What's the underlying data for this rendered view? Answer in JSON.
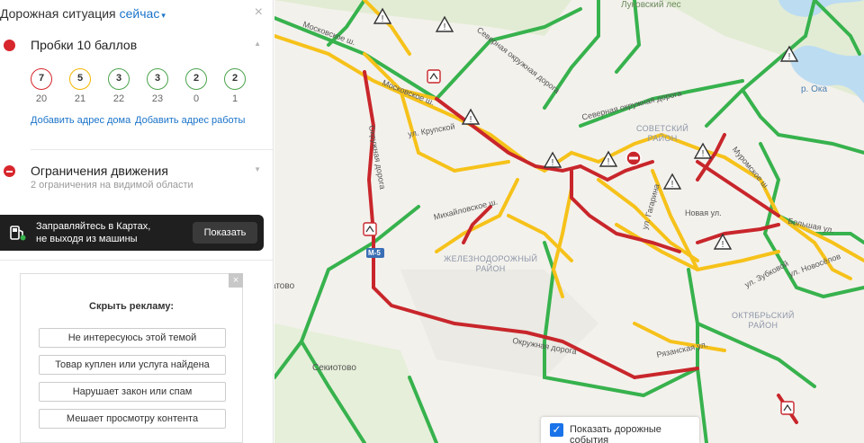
{
  "header": {
    "title": "Дорожная ситуация",
    "time_link": "сейчас",
    "caret": "▾",
    "close": "×"
  },
  "jams": {
    "title": "Пробки 10 баллов",
    "forecast": [
      {
        "score": "7",
        "hour": "20",
        "level": "red"
      },
      {
        "score": "5",
        "hour": "21",
        "level": "yellow"
      },
      {
        "score": "3",
        "hour": "22",
        "level": "green"
      },
      {
        "score": "3",
        "hour": "23",
        "level": "green"
      },
      {
        "score": "2",
        "hour": "0",
        "level": "green"
      },
      {
        "score": "2",
        "hour": "1",
        "level": "green"
      }
    ],
    "add_home": "Добавить адрес дома",
    "add_work": "Добавить адрес работы"
  },
  "restrictions": {
    "title": "Ограничения движения",
    "subtitle": "2 ограничения на видимой области"
  },
  "promo": {
    "line1": "Заправляйтесь в Картах,",
    "line2": "не выходя из машины",
    "button": "Показать"
  },
  "ad_feedback": {
    "title": "Скрыть рекламу:",
    "close": "×",
    "options": [
      "Не интересуюсь этой темой",
      "Товар куплен или услуга найдена",
      "Нарушает закон или спам",
      "Мешает просмотру контента"
    ]
  },
  "map": {
    "labels": {
      "lukovsky": "Луковский лес",
      "moskovskoe1": "Московское ш.",
      "moskovskoe2": "Московское ш.",
      "severnaya": "Северная окружная дорога",
      "severnaya2": "Северная окружная дорога",
      "krupskoy": "ул. Крупской",
      "okruzhnaya_v": "Окружная дорога",
      "mikhaylovskoe": "Михайловское ш.",
      "gagarina": "ул. Гагарина",
      "novaya": "Новая ул.",
      "bolshaya": "Большая ул.",
      "novosyolov": "ул. Новосёлов",
      "zubkovoy": "ул. Зубковой",
      "okruzhnaya_s": "Окружная дорога",
      "ryazanskaya": "Рязанская ул.",
      "murom": "Муромское ш.",
      "oka": "р. Ока",
      "m5": "М-5",
      "atovo": "атово",
      "sekiotovo": "Секиотово"
    },
    "districts": {
      "sovetsky": [
        "СОВЕТСКИЙ",
        "РАЙОН"
      ],
      "zheleznodorozhny": [
        "ЖЕЛЕЗНОДОРОЖНЫЙ",
        "РАЙОН"
      ],
      "oktyabrsky": [
        "ОКТЯБРЬСКИЙ",
        "РАЙОН"
      ]
    },
    "events_toggle": {
      "label": "Показать дорожные события",
      "checked": true
    }
  },
  "colors": {
    "jam_red": "#c8262b",
    "jam_yellow": "#f6c21a",
    "free_green": "#37b24d",
    "link": "#1a73c9"
  },
  "icons": [
    "traffic-light-icon",
    "no-entry-icon",
    "refuel-icon",
    "warning-icon",
    "roadwork-icon",
    "checkbox-icon"
  ]
}
